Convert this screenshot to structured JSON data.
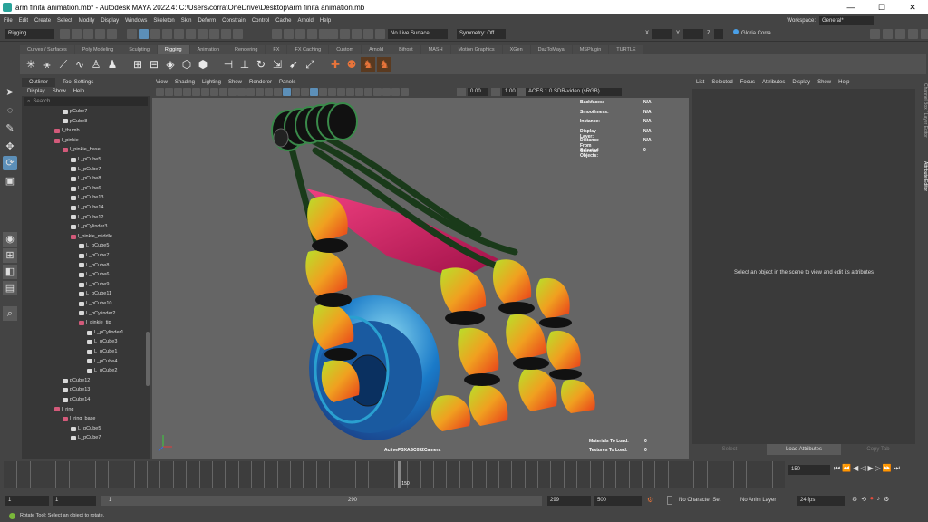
{
  "window": {
    "title": "arm finita animation.mb* - Autodesk MAYA 2022.4: C:\\Users\\corra\\OneDrive\\Desktop\\arm finita animation.mb",
    "minimize": "—",
    "maximize": "☐",
    "close": "✕"
  },
  "menus": [
    "File",
    "Edit",
    "Create",
    "Select",
    "Modify",
    "Display",
    "Windows",
    "Skeleton",
    "Skin",
    "Deform",
    "Constrain",
    "Control",
    "Cache",
    "Arnold",
    "Help"
  ],
  "workspace": {
    "label": "Workspace:",
    "value": "General*"
  },
  "statusline": {
    "menuset": "Rigging",
    "live_surface": "No Live Surface",
    "symmetry": "Symmetry: Off",
    "x_label": "X",
    "y_label": "Y",
    "z_label": "Z",
    "user": "Gloria Corra"
  },
  "shelf_tabs": [
    "Curves / Surfaces",
    "Poly Modeling",
    "Sculpting",
    "Rigging",
    "Animation",
    "Rendering",
    "FX",
    "FX Caching",
    "Custom",
    "Arnold",
    "Bifrost",
    "MASH",
    "Motion Graphics",
    "XGen",
    "DazToMaya",
    "MSPlugin",
    "TURTLE"
  ],
  "active_shelf": "Rigging",
  "outliner": {
    "tabs": [
      "Outliner",
      "Tool Settings"
    ],
    "menu": [
      "Display",
      "Show",
      "Help"
    ],
    "search_placeholder": "Search...",
    "rows": [
      {
        "label": "pCube7",
        "indent": 5,
        "type": "mesh"
      },
      {
        "label": "pCube8",
        "indent": 5,
        "type": "mesh"
      },
      {
        "label": "l_thumb",
        "indent": 4,
        "type": "joint"
      },
      {
        "label": "l_pinkie",
        "indent": 4,
        "type": "joint"
      },
      {
        "label": "l_pinkie_base",
        "indent": 5,
        "type": "joint"
      },
      {
        "label": "L_pCube5",
        "indent": 6,
        "type": "mesh"
      },
      {
        "label": "L_pCube7",
        "indent": 6,
        "type": "mesh"
      },
      {
        "label": "L_pCube8",
        "indent": 6,
        "type": "mesh"
      },
      {
        "label": "L_pCube6",
        "indent": 6,
        "type": "mesh"
      },
      {
        "label": "L_pCube13",
        "indent": 6,
        "type": "mesh"
      },
      {
        "label": "L_pCube14",
        "indent": 6,
        "type": "mesh"
      },
      {
        "label": "L_pCube12",
        "indent": 6,
        "type": "mesh"
      },
      {
        "label": "L_pCylinder3",
        "indent": 6,
        "type": "mesh"
      },
      {
        "label": "l_pinkie_middle",
        "indent": 6,
        "type": "joint"
      },
      {
        "label": "L_pCube5",
        "indent": 7,
        "type": "mesh"
      },
      {
        "label": "L_pCube7",
        "indent": 7,
        "type": "mesh"
      },
      {
        "label": "L_pCube8",
        "indent": 7,
        "type": "mesh"
      },
      {
        "label": "L_pCube6",
        "indent": 7,
        "type": "mesh"
      },
      {
        "label": "L_pCube9",
        "indent": 7,
        "type": "mesh"
      },
      {
        "label": "L_pCube11",
        "indent": 7,
        "type": "mesh"
      },
      {
        "label": "L_pCube10",
        "indent": 7,
        "type": "mesh"
      },
      {
        "label": "L_pCylinder2",
        "indent": 7,
        "type": "mesh"
      },
      {
        "label": "l_pinkie_tip",
        "indent": 7,
        "type": "joint"
      },
      {
        "label": "L_pCylinder1",
        "indent": 8,
        "type": "mesh"
      },
      {
        "label": "L_pCube3",
        "indent": 8,
        "type": "mesh"
      },
      {
        "label": "L_pCube1",
        "indent": 8,
        "type": "mesh"
      },
      {
        "label": "L_pCube4",
        "indent": 8,
        "type": "mesh"
      },
      {
        "label": "L_pCube2",
        "indent": 8,
        "type": "mesh"
      },
      {
        "label": "pCube12",
        "indent": 5,
        "type": "mesh"
      },
      {
        "label": "pCube13",
        "indent": 5,
        "type": "mesh"
      },
      {
        "label": "pCube14",
        "indent": 5,
        "type": "mesh"
      },
      {
        "label": "l_ring",
        "indent": 4,
        "type": "joint"
      },
      {
        "label": "l_ring_base",
        "indent": 5,
        "type": "joint"
      },
      {
        "label": "L_pCube5",
        "indent": 6,
        "type": "mesh"
      },
      {
        "label": "L_pCube7",
        "indent": 6,
        "type": "mesh"
      }
    ]
  },
  "viewport": {
    "menu": [
      "View",
      "Shading",
      "Lighting",
      "Show",
      "Renderer",
      "Panels"
    ],
    "exposure": "0.00",
    "gamma": "1.00",
    "colorspace": "ACES 1.0 SDR-video (sRGB)",
    "hud": [
      {
        "label": "Backfaces:",
        "value": "N/A"
      },
      {
        "label": "Smoothness:",
        "value": "N/A"
      },
      {
        "label": "Instance:",
        "value": "N/A"
      },
      {
        "label": "Display Layer:",
        "value": "N/A"
      },
      {
        "label": "Distance From Camera:",
        "value": "N/A"
      },
      {
        "label": "Selected Objects:",
        "value": "0"
      }
    ],
    "hud_bottom": [
      {
        "label": "Materials To Load:",
        "value": "0"
      },
      {
        "label": "Textures To Load:",
        "value": "0"
      }
    ],
    "camera": "ActiveFBXASC032Camera"
  },
  "attribute_editor": {
    "menu": [
      "List",
      "Selected",
      "Focus",
      "Attributes",
      "Display",
      "Show",
      "Help"
    ],
    "message": "Select an object in the scene to view and edit its attributes",
    "buttons": [
      "Select",
      "Load Attributes",
      "Copy Tab"
    ],
    "side_tabs": [
      "Channel Box / Layer Editor",
      "Attribute Editor"
    ]
  },
  "timeline": {
    "current_frame": "150",
    "playhead_label": "150",
    "tick_labels": [
      "5",
      "10",
      "15",
      "20",
      "25",
      "30",
      "35",
      "40",
      "45",
      "50",
      "55",
      "60",
      "65",
      "70",
      "75",
      "80",
      "85",
      "90",
      "95",
      "100",
      "105",
      "110",
      "115",
      "120",
      "125",
      "130",
      "135",
      "140",
      "145",
      "150",
      "155",
      "160",
      "165",
      "170",
      "175",
      "180",
      "185",
      "190",
      "195",
      "200",
      "205",
      "210",
      "215",
      "220",
      "225",
      "230",
      "235",
      "240",
      "245",
      "250",
      "255",
      "260",
      "265",
      "270",
      "275",
      "280",
      "285",
      "290",
      "295"
    ],
    "playhead_fraction": 0.505
  },
  "range": {
    "start": "1",
    "anim_start": "1",
    "slider_start": "1",
    "slider_end": "290",
    "anim_end": "299",
    "end": "500",
    "character_set": "No Character Set",
    "anim_layer": "No Anim Layer",
    "fps": "24 fps"
  },
  "helpline": {
    "text": "Rotate Tool: Select an object to rotate."
  }
}
